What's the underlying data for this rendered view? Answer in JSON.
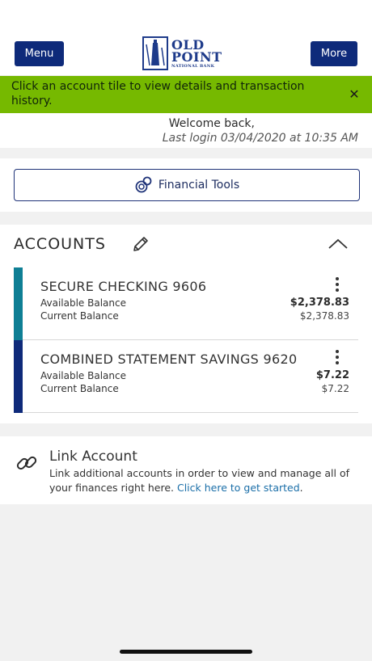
{
  "header": {
    "menu_label": "Menu",
    "more_label": "More",
    "logo_line1": "OLD",
    "logo_line2": "POINT",
    "logo_line3": "NATIONAL BANK",
    "brand_color": "#0e2a7a"
  },
  "banner": {
    "text": "Click an account tile to view details and transaction history.",
    "close_glyph": "✕",
    "color": "#76b900"
  },
  "welcome": {
    "greeting": "Welcome back,",
    "last_login": "Last login 03/04/2020 at 10:35 AM"
  },
  "tools": {
    "label": "Financial Tools",
    "icon": "coins-icon"
  },
  "accounts": {
    "title": "ACCOUNTS",
    "edit_icon": "pencil-icon",
    "collapse_icon": "chevron-up-icon",
    "items": [
      {
        "name": "SECURE CHECKING 9606",
        "available_label": "Available Balance",
        "available_value": "$2,378.83",
        "current_label": "Current Balance",
        "current_value": "$2,378.83",
        "stripe_color": "#0f7f95"
      },
      {
        "name": "COMBINED STATEMENT SAVINGS 9620",
        "available_label": "Available Balance",
        "available_value": "$7.22",
        "current_label": "Current Balance",
        "current_value": "$7.22",
        "stripe_color": "#0e2a7a"
      }
    ]
  },
  "link_account": {
    "title": "Link Account",
    "description": "Link additional accounts in order to view and manage all of your finances right here.",
    "cta": "Click here to get started",
    "cta_suffix": ".",
    "icon": "link-icon"
  }
}
